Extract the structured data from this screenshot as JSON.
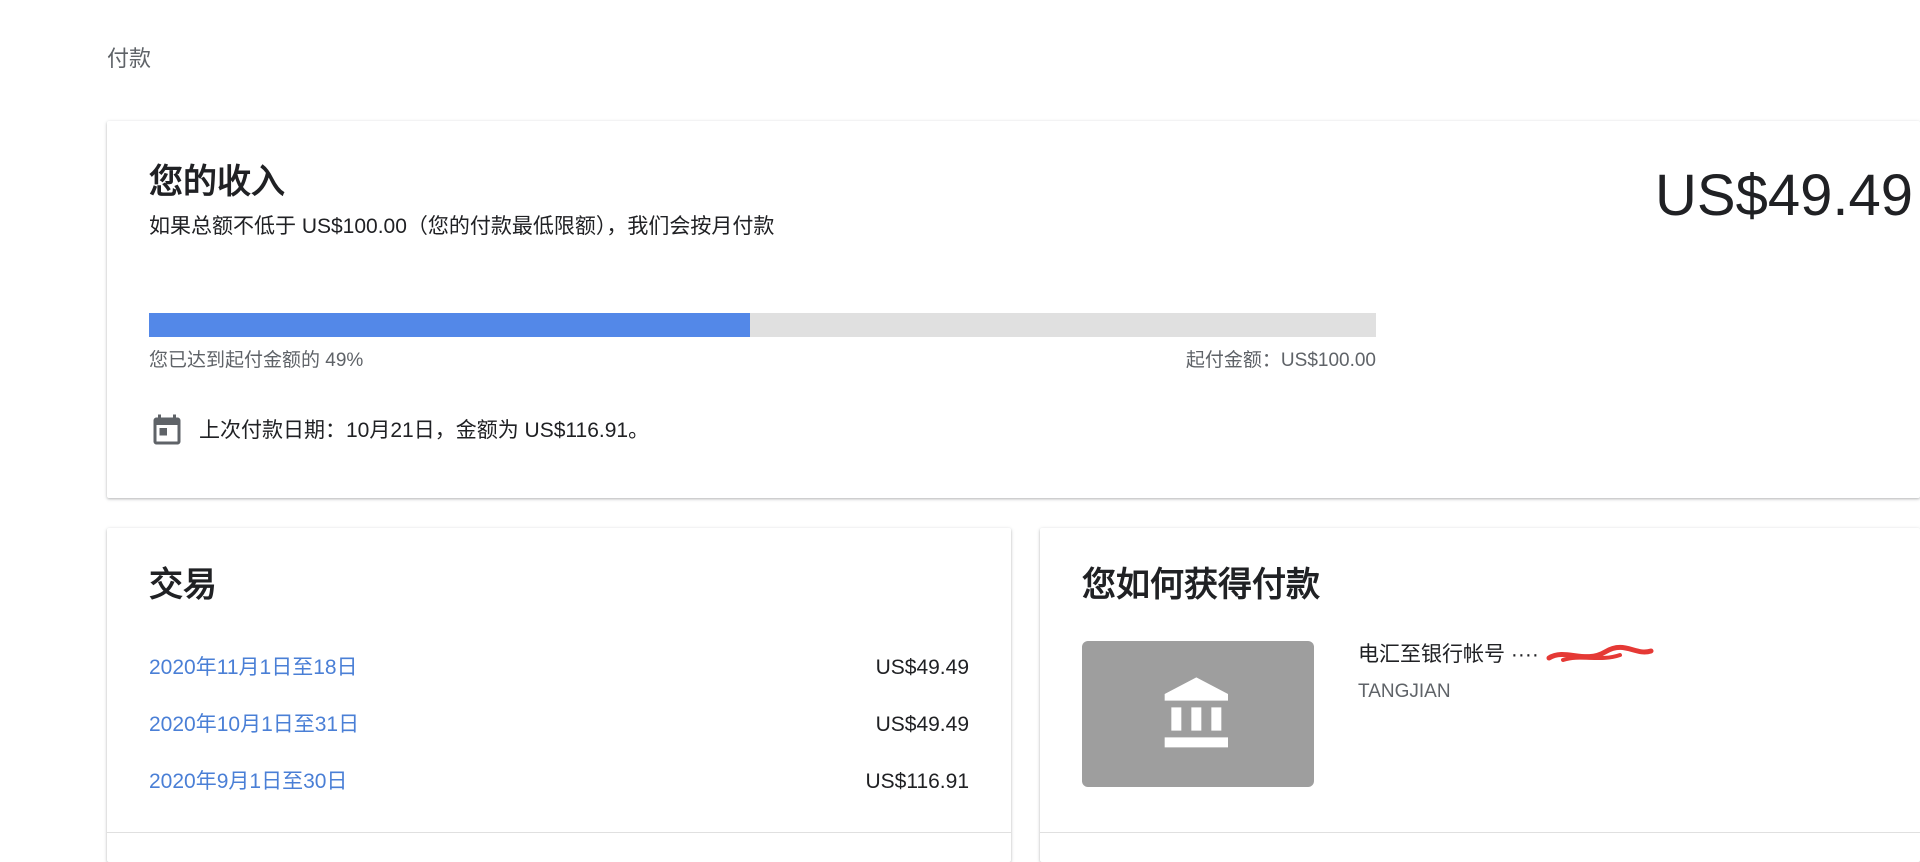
{
  "page": {
    "title": "付款"
  },
  "earnings": {
    "heading": "您的收入",
    "subtitle": "如果总额不低于 US$100.00（您的付款最低限额），我们会按月付款",
    "balance": "US$49.49",
    "progress_percent": 49,
    "progress_label": "您已达到起付金额的 49%",
    "threshold_label": "起付金额：US$100.00",
    "calendar_icon": "calendar-icon",
    "last_payment_text": "上次付款日期：10月21日，金额为 US$116.91。",
    "accent_color": "#5388e8"
  },
  "transactions": {
    "title": "交易",
    "rows": [
      {
        "period": "2020年11月1日至18日",
        "amount": "US$49.49"
      },
      {
        "period": "2020年10月1日至31日",
        "amount": "US$49.49"
      },
      {
        "period": "2020年9月1日至30日",
        "amount": "US$116.91"
      }
    ],
    "link_color": "#4a7fd6"
  },
  "how_paid": {
    "title": "您如何获得付款",
    "bank_icon": "bank-icon",
    "method_label": "电汇至银行帐号 ····",
    "account_holder": "TANGJIAN"
  }
}
